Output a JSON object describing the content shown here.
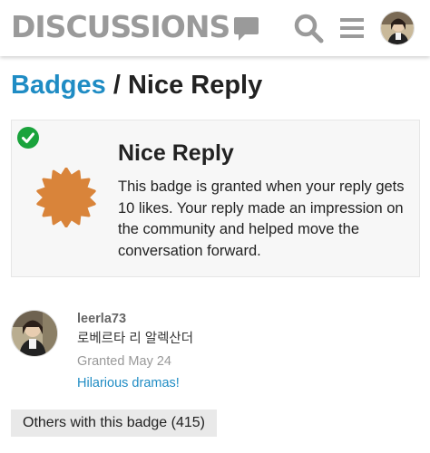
{
  "header": {
    "logo_text": "DISCUSSIONS",
    "logo_icon": "speech-bubble-icon",
    "search_icon": "search-icon",
    "menu_icon": "hamburger-menu-icon",
    "avatar": "user-avatar"
  },
  "breadcrumb": {
    "parent": "Badges",
    "separator": "/",
    "current": "Nice Reply"
  },
  "badge": {
    "name": "Nice Reply",
    "description": "This badge is granted when your reply gets 10 likes. Your reply made an impression on the community and helped move the conversation forward.",
    "status_icon": "check-circle-icon",
    "badge_icon": "badge-sun-icon",
    "badge_color": "#d9843a",
    "check_color": "#1aa33c"
  },
  "grant": {
    "username": "leerla73",
    "real_name": "로베르타 리 알렉산더",
    "granted": "Granted May 24",
    "topic": "Hilarious dramas!"
  },
  "others_button": "Others with this badge (415)",
  "colors": {
    "link": "#1f8cc4",
    "logo_gray": "#9a9a9a"
  }
}
